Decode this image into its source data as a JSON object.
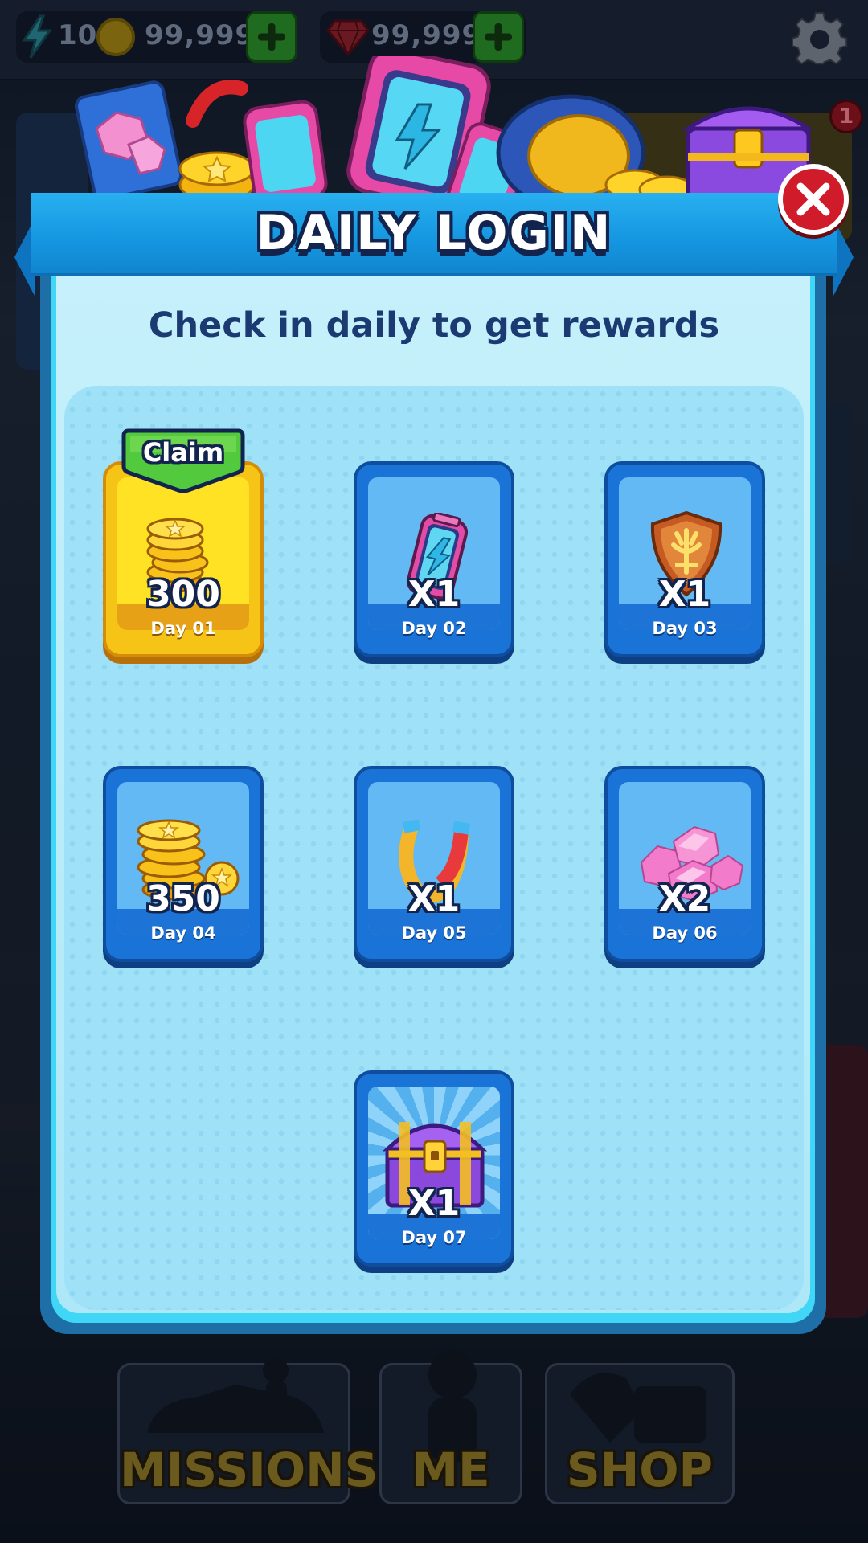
{
  "topbar": {
    "energy_value": "10",
    "coins_value": "99,999",
    "gems_value": "99,999"
  },
  "notification": {
    "count": "1"
  },
  "modal": {
    "title": "DAILY LOGIN",
    "subtitle": "Check in daily to get rewards",
    "claim_label": "Claim"
  },
  "rewards": [
    {
      "day": "Day 01",
      "qty": "300",
      "item": "coin-stack-icon",
      "state": "claimable"
    },
    {
      "day": "Day 02",
      "qty": "X1",
      "item": "energy-battery-icon",
      "state": "locked"
    },
    {
      "day": "Day 03",
      "qty": "X1",
      "item": "shield-icon",
      "state": "locked"
    },
    {
      "day": "Day 04",
      "qty": "350",
      "item": "coin-stack-icon",
      "state": "locked"
    },
    {
      "day": "Day 05",
      "qty": "X1",
      "item": "magnet-icon",
      "state": "locked"
    },
    {
      "day": "Day 06",
      "qty": "X2",
      "item": "gem-pile-icon",
      "state": "locked"
    },
    {
      "day": "Day 07",
      "qty": "X1",
      "item": "treasure-chest-icon",
      "state": "locked"
    }
  ],
  "nav": {
    "missions": "MISSIONS",
    "me": "ME",
    "shop": "SHOP"
  },
  "colors": {
    "banner_blue": "#1596e0",
    "card_blue": "#1a74d8",
    "card_gold": "#f6c416",
    "claim_green": "#4cc43a",
    "close_red": "#d01b2a",
    "title_outline": "#12244e"
  }
}
